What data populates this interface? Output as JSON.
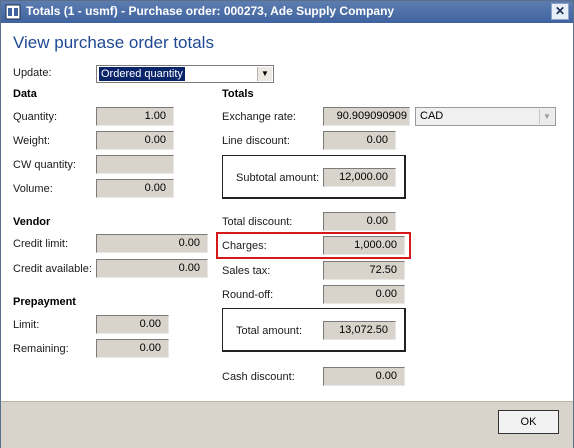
{
  "window": {
    "title": "Totals (1 - usmf) - Purchase order: 000273, Ade Supply Company",
    "close_label": "✕"
  },
  "heading": "View purchase order totals",
  "update": {
    "label": "Update:",
    "value": "Ordered quantity"
  },
  "data_section": {
    "title": "Data",
    "quantity": {
      "label": "Quantity:",
      "value": "1.00"
    },
    "weight": {
      "label": "Weight:",
      "value": "0.00"
    },
    "cw_quantity": {
      "label": "CW quantity:",
      "value": ""
    },
    "volume": {
      "label": "Volume:",
      "value": "0.00"
    }
  },
  "vendor_section": {
    "title": "Vendor",
    "credit_limit": {
      "label": "Credit limit:",
      "value": "0.00"
    },
    "credit_available": {
      "label": "Credit available:",
      "value": "0.00"
    }
  },
  "prepayment_section": {
    "title": "Prepayment",
    "limit": {
      "label": "Limit:",
      "value": "0.00"
    },
    "remaining": {
      "label": "Remaining:",
      "value": "0.00"
    }
  },
  "totals_section": {
    "title": "Totals",
    "exchange_rate": {
      "label": "Exchange rate:",
      "value": "90.909090909",
      "currency": "CAD"
    },
    "line_discount": {
      "label": "Line discount:",
      "value": "0.00"
    },
    "subtotal": {
      "label": "Subtotal amount:",
      "value": "12,000.00"
    },
    "total_discount": {
      "label": "Total discount:",
      "value": "0.00"
    },
    "charges": {
      "label": "Charges:",
      "value": "1,000.00"
    },
    "sales_tax": {
      "label": "Sales tax:",
      "value": "72.50"
    },
    "round_off": {
      "label": "Round-off:",
      "value": "0.00"
    },
    "total_amount": {
      "label": "Total amount:",
      "value": "13,072.50"
    },
    "cash_discount": {
      "label": "Cash discount:",
      "value": "0.00"
    }
  },
  "buttons": {
    "ok": "OK"
  },
  "colors": {
    "highlight": "#d41919",
    "heading": "#1f4a93",
    "titlebar": "#3f63a0"
  }
}
